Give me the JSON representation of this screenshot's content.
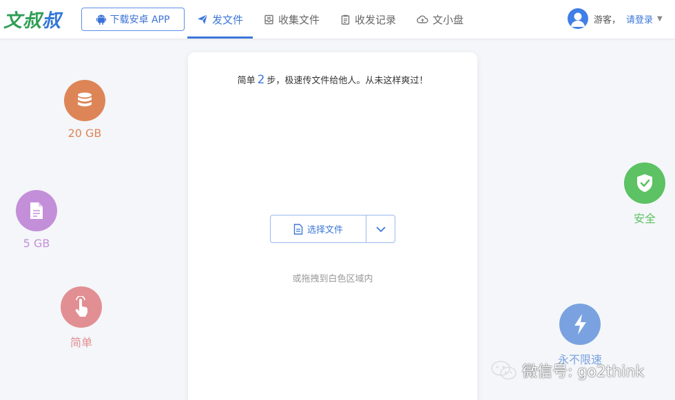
{
  "header": {
    "logo_part1": "文叔",
    "logo_part2": "叔",
    "download_label": "下载安卓 APP",
    "nav": [
      {
        "label": "发文件",
        "icon": "send-icon"
      },
      {
        "label": "收集文件",
        "icon": "inbox-icon"
      },
      {
        "label": "收发记录",
        "icon": "clipboard-icon"
      },
      {
        "label": "文小盘",
        "icon": "cloud-icon"
      }
    ],
    "guest_label": "游客，",
    "login_label": "请登录"
  },
  "card": {
    "steps_prefix": "简单",
    "steps_num": "2",
    "steps_suffix": "步，极速传文件给他人。从未这样爽过！",
    "choose_label": "选择文件",
    "drag_hint": "或拖拽到白色区域内"
  },
  "features": {
    "storage": "20 GB",
    "file_size": "5 GB",
    "simple": "简单",
    "safe": "安全",
    "speed": "永不限速"
  },
  "watermark": "微信号: go2think",
  "colors": {
    "accent": "#3b76d9",
    "logo_green": "#2f9e55",
    "storage": "#dd8557",
    "file": "#c48fd9",
    "simple": "#e28f93",
    "safe": "#5cc263",
    "speed": "#7aa2e0"
  }
}
